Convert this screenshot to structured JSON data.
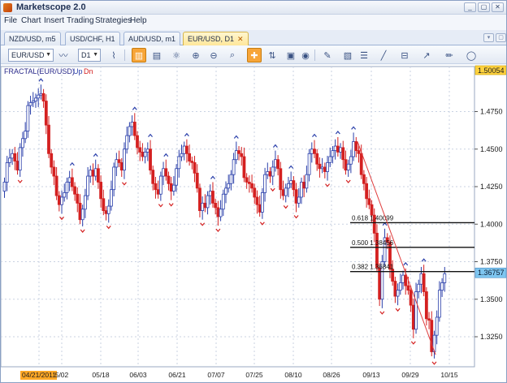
{
  "app": {
    "title": "Marketscope 2.0",
    "window_buttons": [
      "_",
      "▢",
      "✕"
    ]
  },
  "menu": [
    "File",
    "Chart",
    "Insert",
    "Trading",
    "Strategies",
    "Help"
  ],
  "tabs": [
    {
      "label": "NZD/USD, m5",
      "active": false
    },
    {
      "label": "USD/CHF, H1",
      "active": false
    },
    {
      "label": "AUD/USD, m1",
      "active": false
    },
    {
      "label": "EUR/USD, D1",
      "active": true,
      "close": "✕"
    }
  ],
  "toolbar": {
    "symbol": "EUR/USD",
    "timeframe": "D1",
    "icons": [
      "line-chart-icon",
      "candles-icon",
      "bars-icon",
      "indicators-icon",
      "zoom-in-icon",
      "zoom-out-icon",
      "zoom-fit-icon",
      "crosshair-icon",
      "trade-icon",
      "globe-icon",
      "pencil-icon",
      "image-icon",
      "fib-icon",
      "hline-icon",
      "trendline-icon",
      "drawing-icon",
      "ellipse-icon"
    ]
  },
  "colors": {
    "up": "#2a3faa",
    "down": "#d42020",
    "trendline": "#e03c3c",
    "price_tag": "#7ec6f0",
    "top_tag": "#ffd23f",
    "date_tag": "#ffa826"
  },
  "chart_data": {
    "type": "candlestick",
    "indicator": {
      "name": "FRACTAL(EUR/USD)",
      "up_label": "Up",
      "down_label": "Dn"
    },
    "ylim": [
      1.305,
      1.505
    ],
    "yticks": [
      "1.4750",
      "1.4500",
      "1.4250",
      "1.4000",
      "1.3750",
      "1.3500",
      "1.3250"
    ],
    "ytick_values": [
      1.475,
      1.45,
      1.425,
      1.4,
      1.375,
      1.35,
      1.325
    ],
    "xtick_labels": [
      "04/21/2011",
      "5/02",
      "05/18",
      "06/03",
      "06/21",
      "07/07",
      "07/25",
      "08/10",
      "08/26",
      "09/13",
      "09/29",
      "10/15"
    ],
    "current_price": "1.36757",
    "top_price": "1.50054",
    "fib_levels": [
      {
        "label": "0.618  1.40099",
        "value": 1.40099
      },
      {
        "label": "0.500  1.38456",
        "value": 1.38456
      },
      {
        "label": "0.382  1.36841",
        "value": 1.36841
      }
    ],
    "trendline": {
      "from": {
        "index": 136,
        "price": 1.455
      },
      "to": {
        "index": 166,
        "price": 1.313
      }
    },
    "closes": [
      1.428,
      1.441,
      1.444,
      1.447,
      1.442,
      1.436,
      1.451,
      1.457,
      1.462,
      1.479,
      1.481,
      1.482,
      1.484,
      1.486,
      1.487,
      1.482,
      1.466,
      1.447,
      1.438,
      1.432,
      1.419,
      1.413,
      1.418,
      1.421,
      1.428,
      1.431,
      1.425,
      1.42,
      1.414,
      1.403,
      1.41,
      1.419,
      1.432,
      1.436,
      1.432,
      1.437,
      1.428,
      1.417,
      1.409,
      1.407,
      1.412,
      1.423,
      1.438,
      1.443,
      1.441,
      1.436,
      1.45,
      1.459,
      1.465,
      1.468,
      1.459,
      1.451,
      1.448,
      1.445,
      1.448,
      1.45,
      1.436,
      1.427,
      1.423,
      1.42,
      1.432,
      1.437,
      1.432,
      1.427,
      1.422,
      1.426,
      1.437,
      1.445,
      1.447,
      1.452,
      1.447,
      1.442,
      1.441,
      1.434,
      1.424,
      1.409,
      1.414,
      1.411,
      1.419,
      1.422,
      1.414,
      1.411,
      1.405,
      1.41,
      1.42,
      1.424,
      1.427,
      1.433,
      1.443,
      1.449,
      1.447,
      1.445,
      1.431,
      1.428,
      1.427,
      1.424,
      1.418,
      1.413,
      1.408,
      1.421,
      1.433,
      1.435,
      1.432,
      1.438,
      1.443,
      1.437,
      1.423,
      1.419,
      1.424,
      1.427,
      1.429,
      1.423,
      1.414,
      1.418,
      1.428,
      1.424,
      1.433,
      1.447,
      1.45,
      1.447,
      1.44,
      1.437,
      1.438,
      1.435,
      1.441,
      1.445,
      1.449,
      1.452,
      1.448,
      1.451,
      1.443,
      1.436,
      1.44,
      1.445,
      1.455,
      1.449,
      1.447,
      1.433,
      1.427,
      1.417,
      1.413,
      1.406,
      1.394,
      1.371,
      1.35,
      1.375,
      1.391,
      1.388,
      1.37,
      1.362,
      1.352,
      1.356,
      1.361,
      1.366,
      1.359,
      1.356,
      1.346,
      1.33,
      1.355,
      1.36,
      1.367,
      1.355,
      1.337,
      1.336,
      1.315,
      1.326,
      1.338,
      1.356,
      1.361,
      1.367
    ]
  }
}
